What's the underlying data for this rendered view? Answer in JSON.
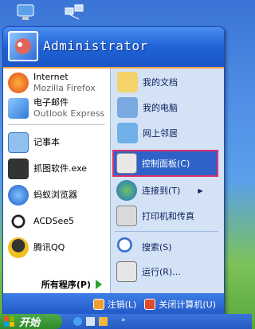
{
  "window": {
    "title": "Start Menu"
  },
  "user": {
    "name": "Administrator"
  },
  "left": {
    "pinned": [
      {
        "label": "Internet",
        "sub": "Mozilla Firefox",
        "icon": "firefox-icon"
      },
      {
        "label": "电子邮件",
        "sub": "Outlook Express",
        "icon": "outlook-icon"
      }
    ],
    "recent": [
      {
        "label": "记事本",
        "icon": "notepad-icon"
      },
      {
        "label": "抓图软件.exe",
        "icon": "camera-icon"
      },
      {
        "label": "蚂蚁浏览器",
        "icon": "ant-browser-icon"
      },
      {
        "label": "ACDSee5",
        "icon": "acdsee-icon"
      },
      {
        "label": "腾讯QQ",
        "icon": "qq-icon"
      }
    ],
    "all_programs": "所有程序(P)"
  },
  "right": {
    "items": [
      {
        "label": "我的文档",
        "icon": "my-documents-icon"
      },
      {
        "label": "我的电脑",
        "icon": "my-computer-icon"
      },
      {
        "label": "网上邻居",
        "icon": "network-icon"
      },
      {
        "label": "控制面板(C)",
        "icon": "control-panel-icon"
      },
      {
        "label": "连接到(T)",
        "icon": "connect-icon"
      },
      {
        "label": "打印机和传真",
        "icon": "printer-icon"
      },
      {
        "label": "搜索(S)",
        "icon": "search-icon"
      },
      {
        "label": "运行(R)...",
        "icon": "run-icon"
      }
    ]
  },
  "bottom": {
    "logoff": "注销(L)",
    "shutdown": "关闭计算机(U)"
  },
  "taskbar": {
    "start": "开始"
  },
  "colors": {
    "accent": "#2358c8",
    "highlight_border": "#e0306a",
    "right_pane": "#d4e2f6"
  }
}
